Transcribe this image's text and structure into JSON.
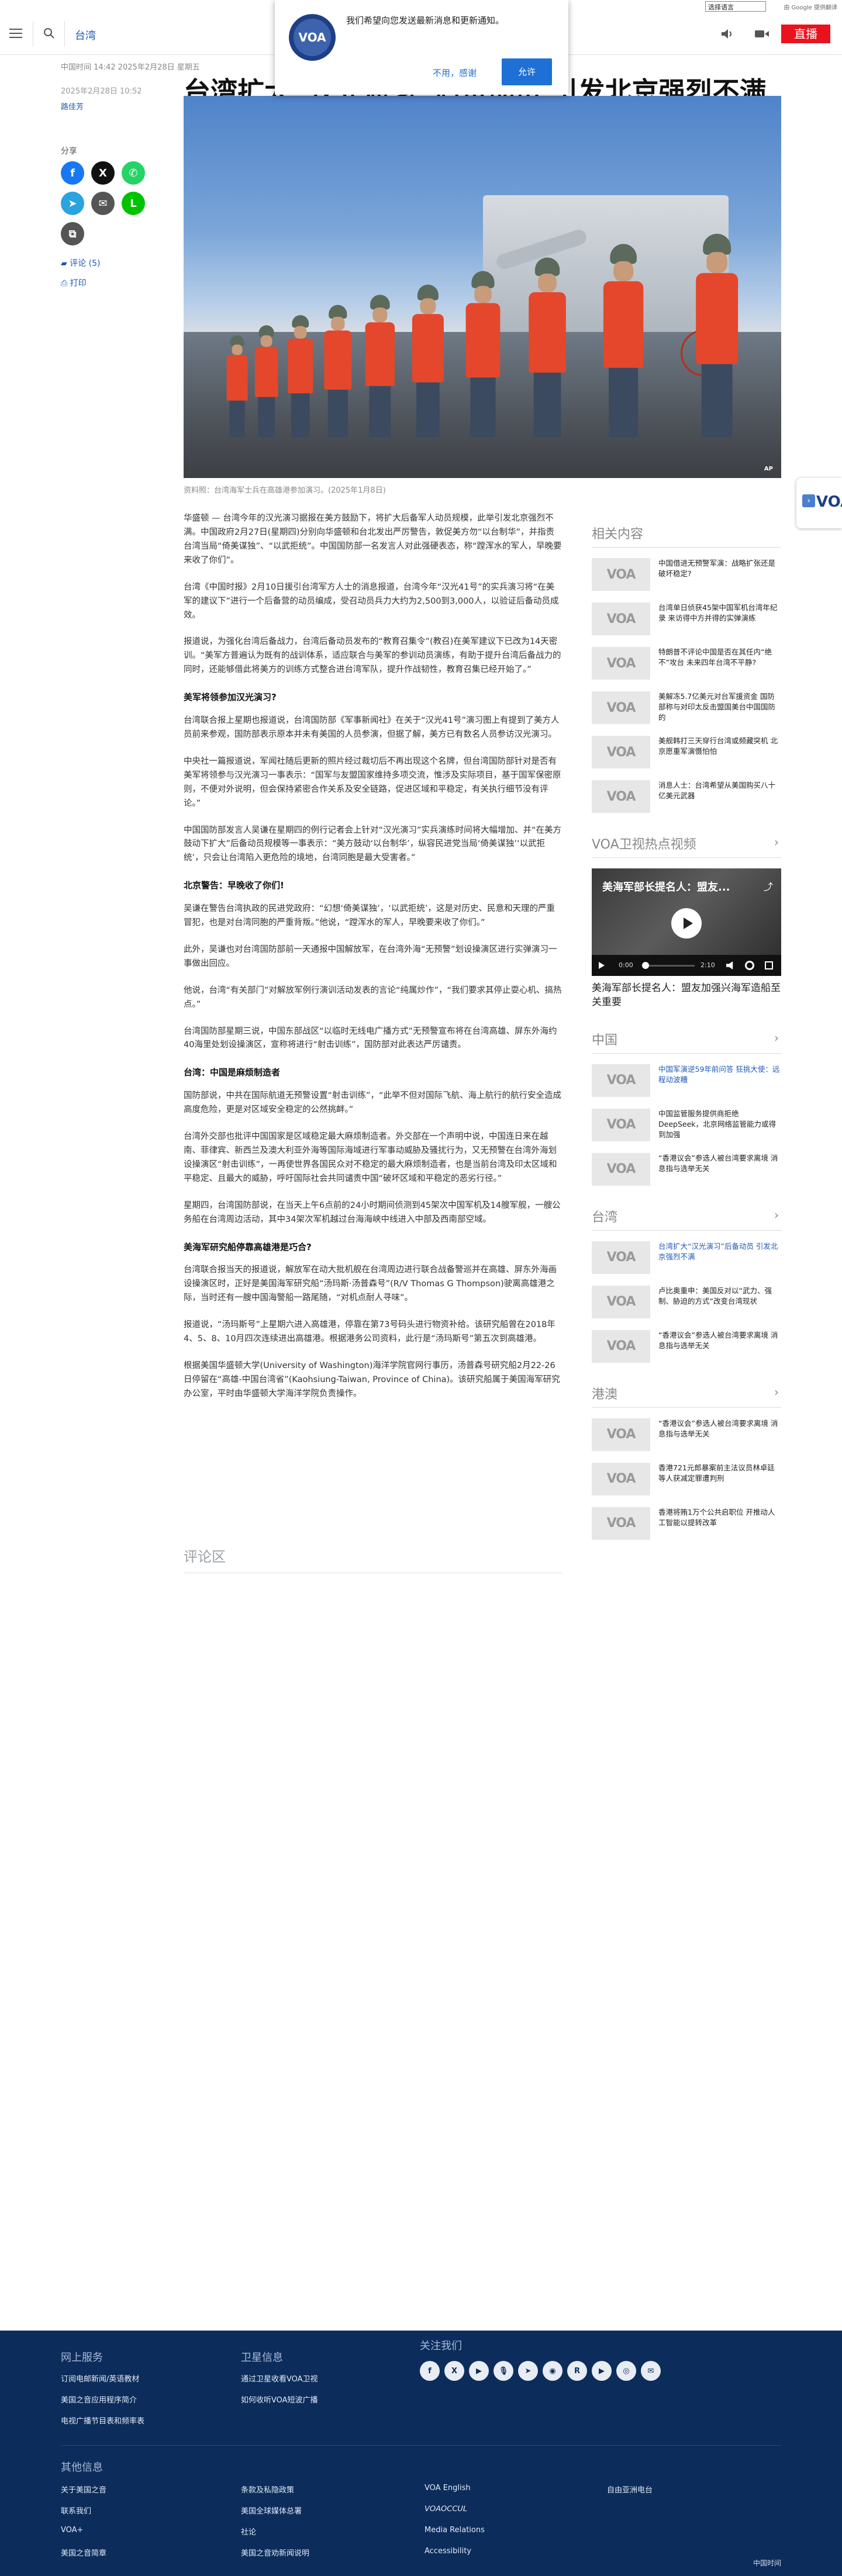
{
  "util_bar": {
    "language_select": "选择语言",
    "google_credit": "由 Google 提供翻译"
  },
  "header": {
    "section": "台湾",
    "live_label": "直播"
  },
  "notification": {
    "text": "我们希望向您发送最新消息和更新通知。",
    "later_label": "不用，感谢",
    "allow_label": "允许"
  },
  "article": {
    "published_line": "中国时间 14:42 2025年2月28日 星期五",
    "date": "2025年2月28日 10:52",
    "author": "路佳芳",
    "headline": "台湾扩大“汉光演习”后备动员 引发北京强烈不满",
    "caption": "资料照：台湾海军士兵在高雄港参加演习。(2025年1月8日)",
    "image_credit": "AP",
    "share_label": "分享",
    "comments_link": "评论 (5)",
    "print_link": "打印",
    "comments_heading": "评论区",
    "body": [
      {
        "type": "p",
        "text": "华盛顿 — 台湾今年的汉光演习据报在美方鼓励下，将扩大后备军人动员规模，此举引发北京强烈不满。中国政府2月27日(星期四)分别向华盛顿和台北发出严厉警告，敦促美方勿“以台制华”，并指责台湾当局“倚美谋独”、“以武拒统”。中国国防部一名发言人对此强硬表态，称“蹚浑水的军人，早晚要来收了你们”。"
      },
      {
        "type": "p",
        "text": "台湾《中国时报》2月10日援引台湾军方人士的消息报道，台湾今年“汉光41号”的实兵演习将“在美军的建议下”进行一个后备营的动员编成，受召动员兵力大约为2,500到3,000人，以验证后备动员成效。"
      },
      {
        "type": "p",
        "text": "报道说，为强化台湾后备战力，台湾后备动员发布的“教育召集令”(教召)在美军建议下已改为14天密训。“美军方普遍认为既有的战训体系，适应联合与美军的参训动员演练，有助于提升台湾后备战力的同时，还能够借此将美方的训练方式整合进台湾军队，提升作战韧性，教育召集已经开始了。”"
      },
      {
        "type": "h3",
        "text": "美军将领参加汉光演习?"
      },
      {
        "type": "p",
        "text": "台湾联合报上星期也报道说，台湾国防部《军事新闻社》在关于“汉光41号”演习图上有提到了美方人员前来参观，国防部表示原本并未有美国的人员参演，但据了解，美方已有数名人员参访汉光演习。"
      },
      {
        "type": "p",
        "text": "中央社一篇报道说，军闻社随后更新的照片经过裁切后不再出现这个名牌，但台湾国防部针对是否有美军将领参与汉光演习一事表示：“国军与友盟国家维持多项交流，惟涉及实际项目，基于国军保密原则，不便对外说明，但会保持紧密合作关系及安全链路，促进区域和平稳定，有关执行细节没有评论。”"
      },
      {
        "type": "p",
        "text": "中国国防部发言人吴谦在星期四的例行记者会上针对“汉光演习”实兵演练时间将大幅增加、并“在美方鼓动下扩大”后备动员规模等一事表示：“美方鼓动‘以台制华’，纵容民进党当局‘倚美谋独’‘以武拒统’，只会让台湾陷入更危险的境地，台湾同胞是最大受害者。”"
      },
      {
        "type": "h3",
        "text": "北京警告：早晚收了你们!"
      },
      {
        "type": "p",
        "text": "吴谦在警告台湾执政的民进党政府：“幻想‘倚美谋独’，‘以武拒统’，这是对历史、民意和天理的严重冒犯，也是对台湾同胞的严重背叛。”他说，“蹚浑水的军人，早晚要来收了你们。”"
      },
      {
        "type": "p",
        "text": "此外，吴谦也对台湾国防部前一天通报中国解放军，在台湾外海“无预警”划设操演区进行实弹演习一事做出回应。"
      },
      {
        "type": "p",
        "text": "他说，台湾“有关部门”对解放军例行演训活动发表的言论“纯属炒作”，“我们要求其停止耍心机、搞热点。”"
      },
      {
        "type": "p",
        "text": "台湾国防部星期三说，中国东部战区“以临时无线电广播方式”无预警宣布将在台湾高雄、屏东外海约40海里处划设操演区，宣称将进行“射击训练”，国防部对此表达严厉谴责。"
      },
      {
        "type": "h3",
        "text": "台湾：中国是麻烦制造者"
      },
      {
        "type": "p",
        "text": "国防部说，中共在国际航道无预警设置“射击训练”，“此举不但对国际飞航、海上航行的航行安全造成高度危险，更是对区域安全稳定的公然挑衅。”"
      },
      {
        "type": "p",
        "text": "台湾外交部也批评中国国家是区域稳定最大麻烦制造者。外交部在一个声明中说，中国连日来在越南、菲律宾、新西兰及澳大利亚外海等国际海域进行军事动威胁及骚扰行为，又无预警在台湾外海划设操演区“射击训练”，一再使世界各国民众对不稳定的最大麻烦制造者，也是当前台湾及印太区域和平稳定、且最大的威胁，呼吁国际社会共同谴责中国“破坏区域和平稳定的恶劣行径。”"
      },
      {
        "type": "p",
        "text": "星期四，台湾国防部说，在当天上午6点前的24小时期间侦测到45架次中国军机及14艘军舰，一艘公务船在台湾周边活动，其中34架次军机越过台海海峡中线进入中部及西南部空域。"
      },
      {
        "type": "h3",
        "text": "美海军研究船停靠高雄港是巧合?"
      },
      {
        "type": "p",
        "text": "台湾联合报当天的报道说，解放军在动大批机舰在台湾周边进行联合战备警巡并在高雄、屏东外海画设操演区时，正好是美国海军研究船“汤玛斯·汤普森号”(R/V Thomas G Thompson)驶离高雄港之际，当时还有一艘中国海警船一路尾随，“对机点耐人寻味”。"
      },
      {
        "type": "p",
        "text": "报道说，“汤玛斯号”上星期六进入高雄港，停靠在第73号码头进行物资补给。该研究船曾在2018年4、5、8、10月四次连续进出高雄港。根据港务公司资料，此行是“汤玛斯号”第五次到高雄港。"
      },
      {
        "type": "p",
        "text": "根据美国华盛顿大学(University of Washington)海洋学院官网行事历，汤普森号研究船2月22-26日停留在“高雄-中国台湾省”(Kaohsiung-Taiwan, Province of China)。该研究船属于美国海军研究办公室，平时由华盛顿大学海洋学院负责操作。"
      }
    ]
  },
  "rail": {
    "related": {
      "heading": "相关内容",
      "items": [
        {
          "title": "中国借进无预警军演：战略扩张还是破坏稳定?"
        },
        {
          "title": "台湾单日侦获45架中国军机台湾年纪录 来访得中方并得的实弹演练"
        },
        {
          "title": "特朗普不评论中国是否在其任内“绝不”攻台 未来四年台湾不平静?"
        },
        {
          "title": "美解冻5.7亿美元对台军援资金 国防部称与对印太反击盟国美台中国国防的"
        },
        {
          "title": "美舰韩打三天穿行台湾或频藏突机 北京愿重军演慑怕怕"
        },
        {
          "title": "消息人士：台湾希望从美国购买八十亿美元武器"
        }
      ]
    },
    "video": {
      "heading": "VOA卫视热点视频",
      "title": "美海军部长提名人：盟友...",
      "time": "0:00",
      "duration": "2:10",
      "caption": "美海军部长提名人：盟友加强兴海军造船至关重要"
    },
    "china": {
      "heading": "中国",
      "items": [
        {
          "title": "中国军演逆59年前问答 狂挑大使：远程动波糟",
          "blue": true
        },
        {
          "title": "中国监管服务提供商拒绝DeepSeek，北京网络监管能力或得到加强",
          "blue": false
        },
        {
          "title": "“香港议会”参选人被台湾要求离境 消息指与选举无关",
          "blue": false
        }
      ]
    },
    "taiwan": {
      "heading": "台湾",
      "items": [
        {
          "title": "台湾扩大“汉光演习”后备动员 引发北京强烈不满",
          "blue": true
        },
        {
          "title": "卢比奥重申：美国反对以“武力、强制、胁迫的方式”改变台湾现状",
          "blue": false
        },
        {
          "title": "“香港议会”参选人被台湾要求离境 消息指与选举无关",
          "blue": false
        }
      ]
    },
    "hongkong": {
      "heading": "港澳",
      "items": [
        {
          "title": "“香港议会”参选人被台湾要求离境 消息指与选举无关",
          "blue": false
        },
        {
          "title": "香港721元郎暴案前主法议员林卓廷等人获减定罪遭判刑",
          "blue": false
        },
        {
          "title": "香港将贿1万个公共启职位 开推动人工智能以提转改革",
          "blue": false
        }
      ]
    }
  },
  "side_tab": {
    "logo": "VOA"
  },
  "footer": {
    "col1_heading": "网上服务",
    "col1_links": [
      "订阅电邮新闻/英语教材",
      "美国之音应用程序简介",
      "电视广播节目表和频率表"
    ],
    "col2_heading": "卫星信息",
    "col2_links": [
      "通过卫星收看VOA卫视",
      "如何收听VOA短波广播"
    ],
    "col3_heading": "关注我们",
    "social": [
      "f",
      "X",
      "▶",
      "🎙",
      "➤",
      "◉",
      "R",
      "▶",
      "◎",
      "✉"
    ],
    "other_heading": "其他信息",
    "other_links": [
      [
        "关于美国之音",
        "条款及私隐政策",
        "VOA English",
        "自由亚洲电台"
      ],
      [
        "联系我们",
        "美国全球媒体总署",
        "𝘝𝘖𝘈𝘖𝘊𝘊𝘜𝘓",
        ""
      ],
      [
        "VOA+",
        "社论",
        "Media Relations",
        ""
      ],
      [
        "美国之音简章",
        "美国之音劝新闻说明",
        "Accessibility",
        ""
      ]
    ],
    "time_label": "中国时间"
  }
}
